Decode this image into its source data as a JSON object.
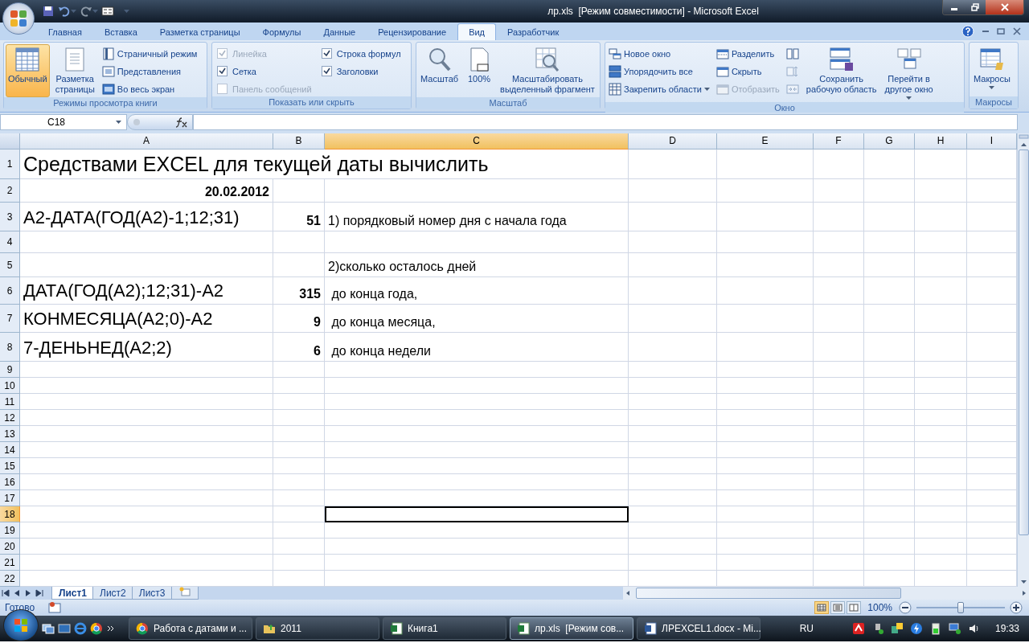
{
  "window": {
    "title": "лр.xls  [Режим совместимости] - Microsoft Excel"
  },
  "ribbon_tabs": [
    {
      "label": "Главная",
      "selected": false
    },
    {
      "label": "Вставка",
      "selected": false
    },
    {
      "label": "Разметка страницы",
      "selected": false
    },
    {
      "label": "Формулы",
      "selected": false
    },
    {
      "label": "Данные",
      "selected": false
    },
    {
      "label": "Рецензирование",
      "selected": false
    },
    {
      "label": "Вид",
      "selected": true
    },
    {
      "label": "Разработчик",
      "selected": false
    }
  ],
  "ribbon_groups": [
    {
      "title": "Режимы просмотра книги",
      "controls": [
        {
          "kind": "large",
          "label": "Обычный",
          "selected": true
        },
        {
          "kind": "large",
          "label": "Разметка\nстраницы",
          "selected": false
        },
        {
          "kind": "stack",
          "items": [
            {
              "kind": "small",
              "label": "Страничный режим"
            },
            {
              "kind": "small",
              "label": "Представления"
            },
            {
              "kind": "small",
              "label": "Во весь экран"
            }
          ]
        }
      ]
    },
    {
      "title": "Показать или скрыть",
      "controls": [
        {
          "kind": "stack",
          "items": [
            {
              "kind": "check",
              "label": "Линейка",
              "checked": true,
              "disabled": true
            },
            {
              "kind": "check",
              "label": "Сетка",
              "checked": true,
              "disabled": false
            },
            {
              "kind": "check",
              "label": "Панель сообщений",
              "checked": false,
              "disabled": true
            }
          ]
        },
        {
          "kind": "stack",
          "items": [
            {
              "kind": "check",
              "label": "Строка формул",
              "checked": true,
              "disabled": false
            },
            {
              "kind": "check",
              "label": "Заголовки",
              "checked": true,
              "disabled": false
            }
          ]
        }
      ]
    },
    {
      "title": "Масштаб",
      "controls": [
        {
          "kind": "large",
          "label": "Масштаб"
        },
        {
          "kind": "large",
          "label": "100%"
        },
        {
          "kind": "large",
          "label": "Масштабировать\nвыделенный фрагмент"
        }
      ]
    },
    {
      "title": "Окно",
      "controls": [
        {
          "kind": "stack",
          "items": [
            {
              "kind": "small",
              "label": "Новое окно",
              "disabled": false
            },
            {
              "kind": "small",
              "label": "Упорядочить все",
              "disabled": false
            },
            {
              "kind": "small",
              "label": "Закрепить области",
              "disabled": false,
              "dropdown": true
            }
          ]
        },
        {
          "kind": "stack",
          "items": [
            {
              "kind": "small",
              "label": "Разделить",
              "disabled": false
            },
            {
              "kind": "small",
              "label": "Скрыть",
              "disabled": false
            },
            {
              "kind": "small",
              "label": "Отобразить",
              "disabled": true
            }
          ]
        },
        {
          "kind": "stack",
          "items": [
            {
              "kind": "icon",
              "disabled": false
            },
            {
              "kind": "icon",
              "disabled": true
            },
            {
              "kind": "icon",
              "disabled": true
            }
          ]
        },
        {
          "kind": "large",
          "label": "Сохранить\nрабочую область"
        },
        {
          "kind": "large",
          "label": "Перейти в\nдругое окно",
          "dropdown": true
        }
      ]
    },
    {
      "title": "Макросы",
      "controls": [
        {
          "kind": "large",
          "label": "Макросы",
          "dropdown": true
        }
      ]
    }
  ],
  "name_box": "C18",
  "columns": [
    {
      "label": "A",
      "selected": false
    },
    {
      "label": "B",
      "selected": false
    },
    {
      "label": "C",
      "selected": true
    },
    {
      "label": "D",
      "selected": false
    },
    {
      "label": "E",
      "selected": false
    },
    {
      "label": "F",
      "selected": false
    },
    {
      "label": "G",
      "selected": false
    },
    {
      "label": "H",
      "selected": false
    },
    {
      "label": "I",
      "selected": false
    }
  ],
  "rows": [
    {
      "number": "1",
      "selected": false,
      "cells": [
        {
          "kind": "heading",
          "text": "Средствами EXCEL для текущей даты вычислить"
        }
      ]
    },
    {
      "number": "2",
      "selected": false,
      "cells": [
        {
          "kind": "number",
          "text": "20.02.2012"
        }
      ]
    },
    {
      "number": "3",
      "selected": false,
      "cells": [
        {
          "kind": "formula",
          "text": "А2-ДАТА(ГОД(А2)-1;12;31)"
        },
        {
          "kind": "number",
          "text": "51"
        },
        {
          "kind": "text",
          "text": "1) порядковый номер дня с начала года"
        }
      ]
    },
    {
      "number": "4",
      "selected": false
    },
    {
      "number": "5",
      "selected": false,
      "cells": [
        {
          "kind": "empty"
        },
        {
          "kind": "empty"
        },
        {
          "kind": "text",
          "text": "2)сколько осталось дней"
        }
      ]
    },
    {
      "number": "6",
      "selected": false,
      "cells": [
        {
          "kind": "formula",
          "text": "ДАТА(ГОД(А2);12;31)-А2"
        },
        {
          "kind": "number",
          "text": "315"
        },
        {
          "kind": "text",
          "text": " до конца года,"
        }
      ]
    },
    {
      "number": "7",
      "selected": false,
      "cells": [
        {
          "kind": "formula",
          "text": "КОНМЕСЯЦА(А2;0)-А2"
        },
        {
          "kind": "number",
          "text": "9"
        },
        {
          "kind": "text",
          "text": " до конца месяца,"
        }
      ]
    },
    {
      "number": "8",
      "selected": false,
      "cells": [
        {
          "kind": "formula",
          "text": "7-ДЕНЬНЕД(А2;2)"
        },
        {
          "kind": "number",
          "text": "6"
        },
        {
          "kind": "text",
          "text": " до конца недели"
        }
      ]
    },
    {
      "number": "9",
      "selected": false
    },
    {
      "number": "10",
      "selected": false
    },
    {
      "number": "11",
      "selected": false
    },
    {
      "number": "12",
      "selected": false
    },
    {
      "number": "13",
      "selected": false
    },
    {
      "number": "14",
      "selected": false
    },
    {
      "number": "15",
      "selected": false
    },
    {
      "number": "16",
      "selected": false
    },
    {
      "number": "17",
      "selected": false
    },
    {
      "number": "18",
      "selected": true
    },
    {
      "number": "19",
      "selected": false
    },
    {
      "number": "20",
      "selected": false
    },
    {
      "number": "21",
      "selected": false
    },
    {
      "number": "22",
      "selected": false
    }
  ],
  "sheet_tabs": [
    {
      "label": "Лист1",
      "selected": true
    },
    {
      "label": "Лист2",
      "selected": false
    },
    {
      "label": "Лист3",
      "selected": false
    }
  ],
  "status_bar": {
    "status": "Готово",
    "view_buttons": [
      {
        "selected": true
      },
      {
        "selected": false
      },
      {
        "selected": false
      }
    ],
    "zoom": {
      "reading": "100%",
      "level": 0.5
    }
  },
  "taskbar": {
    "items": [
      {
        "label": "Работа с датами и ...",
        "selected": false
      },
      {
        "label": "2011",
        "selected": false
      },
      {
        "label": "Книга1",
        "selected": false
      },
      {
        "label": "лр.xls  [Режим сов...",
        "selected": true
      },
      {
        "label": "ЛРEXCEL1.docx - Mi...",
        "selected": false
      }
    ],
    "language": "RU",
    "clock": "19:33"
  }
}
